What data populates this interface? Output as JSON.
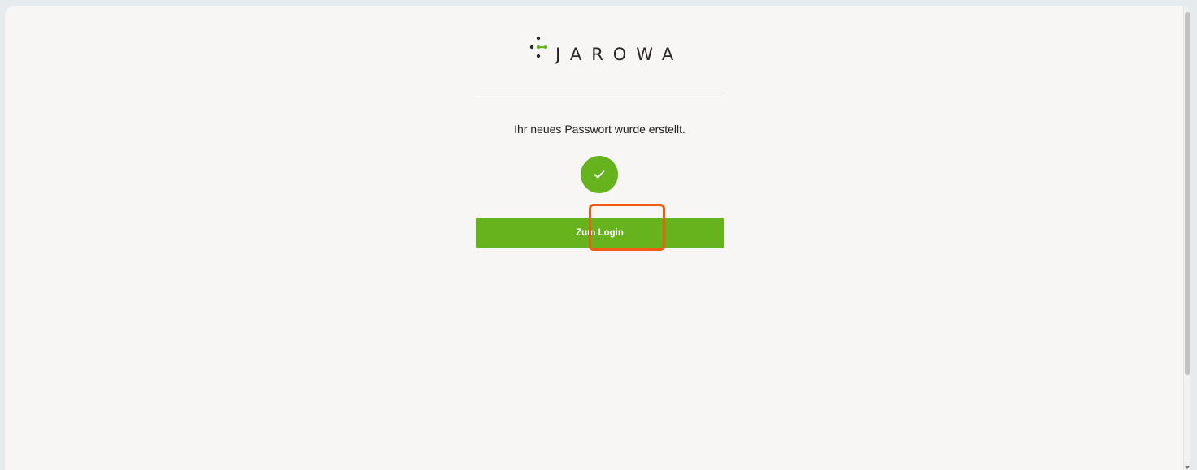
{
  "brand": {
    "name": "JAROWA",
    "accent_color": "#66b31e",
    "icon": "jarowa-logo-mark"
  },
  "message": {
    "text": "Ihr neues Passwort wurde erstellt."
  },
  "status_icon": {
    "icon": "checkmark-icon",
    "color": "#66b31e"
  },
  "actions": {
    "login_label": "Zum Login"
  },
  "annotation": {
    "highlight_color": "#f15a13"
  }
}
